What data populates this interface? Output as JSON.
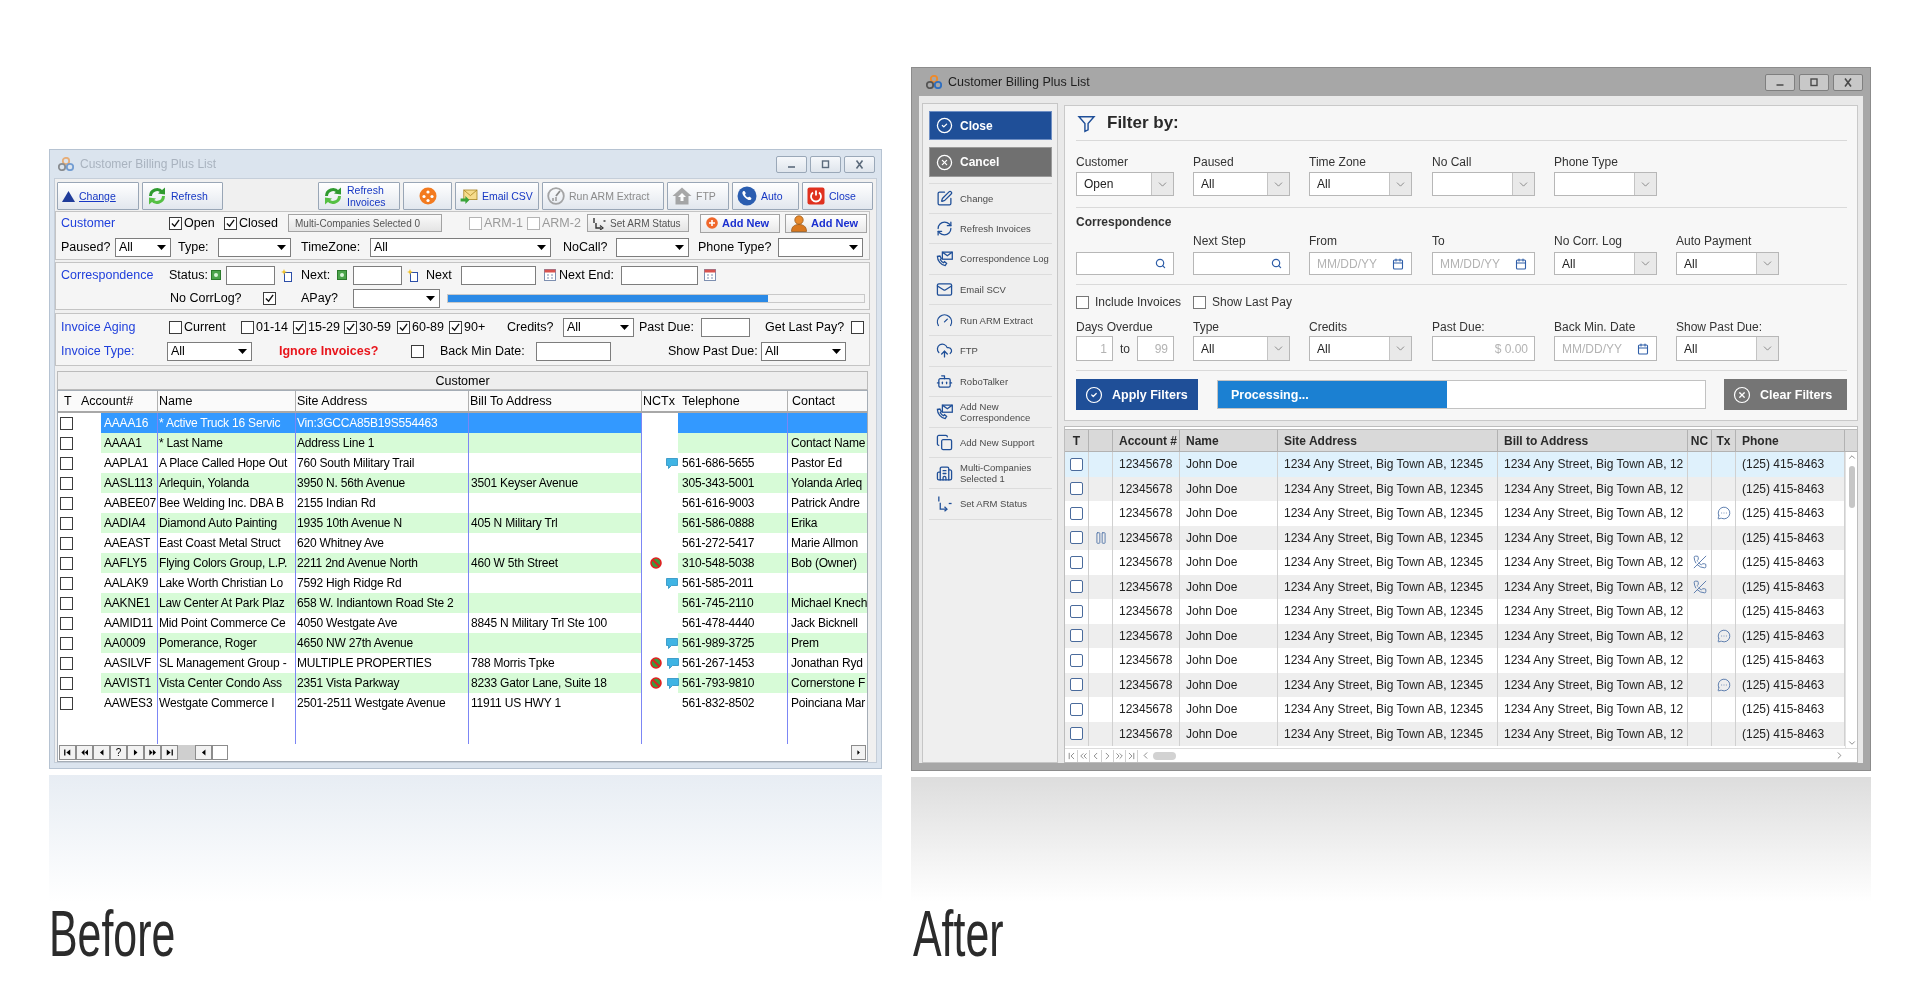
{
  "before_label": "Before",
  "after_label": "After",
  "before_window": {
    "title": "Customer Billing Plus List",
    "toolbar_left": [
      {
        "kind": "change",
        "label": "Change",
        "disabled": false
      },
      {
        "kind": "refresh",
        "label": "Refresh",
        "disabled": false
      }
    ],
    "toolbar_right": [
      {
        "kind": "refresh",
        "label": "Refresh Invoices",
        "disabled": false
      },
      {
        "kind": "record",
        "disabled": false
      },
      {
        "kind": "email",
        "label": "Email CSV",
        "disabled": false
      },
      {
        "kind": "extract",
        "label": "Run ARM Extract",
        "disabled": true
      },
      {
        "kind": "ftp",
        "label": "FTP",
        "disabled": true
      },
      {
        "kind": "auto",
        "label": "Auto",
        "disabled": false
      },
      {
        "kind": "close",
        "label": "Close",
        "disabled": false
      }
    ],
    "customer_section": {
      "title": "Customer",
      "status_checks": [
        {
          "label": "Open",
          "checked": true
        },
        {
          "label": "Closed",
          "checked": true
        }
      ],
      "multi_companies": "Multi-Companies Selected 0",
      "arm_checks": [
        {
          "label": "ARM-1",
          "checked": false,
          "disabled": true
        },
        {
          "label": "ARM-2",
          "checked": false,
          "disabled": true
        }
      ],
      "set_arm_status": "Set ARM Status",
      "add_buttons": [
        {
          "kind": "plus",
          "label": "Add New"
        },
        {
          "kind": "person",
          "label": "Add New"
        }
      ],
      "filters": [
        {
          "label": "Paused?",
          "value": "All"
        },
        {
          "label": "Type:"
        },
        {
          "label": "TimeZone:",
          "value": "All"
        },
        {
          "label": "NoCall?"
        },
        {
          "label": "Phone Type?"
        }
      ]
    },
    "correspondence_section": {
      "title": "Correspondence",
      "status_label": "Status:",
      "next_label": "Next:",
      "next_date_label": "Next",
      "next_end_label": "Next End:",
      "no_corrlog": {
        "label": "No CorrLog?",
        "checked": true
      },
      "apay_label": "APay?",
      "progress": {
        "level": 0.77
      }
    },
    "invoice_section": {
      "aging_title": "Invoice Aging",
      "aging_checks": [
        {
          "label": "Current",
          "checked": false
        },
        {
          "label": "01-14",
          "checked": false
        },
        {
          "label": "15-29",
          "checked": true
        },
        {
          "label": "30-59",
          "checked": true
        },
        {
          "label": "60-89",
          "checked": true
        },
        {
          "label": "90+",
          "checked": true
        }
      ],
      "credits": {
        "label": "Credits?",
        "value": "All"
      },
      "past_due_label": "Past Due:",
      "get_last_pay": {
        "label": "Get Last Pay?",
        "checked": false
      },
      "type_title": "Invoice Type:",
      "type_value": "All",
      "ignore_invoices": {
        "label": "Ignore Invoices?",
        "checked": false
      },
      "back_min_date_label": "Back Min Date:",
      "show_past_due": {
        "label": "Show Past Due:",
        "value": "All"
      }
    },
    "table": {
      "group_header": "Customer",
      "columns": [
        "T",
        "Account#",
        "Name",
        "Site Address",
        "Bill To Address",
        "NCTx",
        "Telephone",
        "Contact"
      ],
      "rows": [
        {
          "checked": false,
          "selected": true,
          "account": "AAAA16",
          "name": "* Active Truck 16 Servic",
          "site_address": "Vin:3GCCA85B19S554463",
          "no_call": false,
          "text_message": false
        },
        {
          "checked": false,
          "selected": false,
          "account": "AAAA1",
          "name": "* Last Name",
          "site_address": "Address Line 1",
          "no_call": false,
          "text_message": false,
          "contact": "Contact Name"
        },
        {
          "checked": false,
          "selected": false,
          "account": "AAPLA1",
          "name": "A Place Called Hope Out",
          "site_address": "760 South Military Trail",
          "no_call": false,
          "text_message": true,
          "telephone": "561-686-5655",
          "contact": "Pastor Ed"
        },
        {
          "checked": false,
          "selected": false,
          "account": "AASL113",
          "name": "Arlequin, Yolanda",
          "site_address": "3950 N. 56th Avenue",
          "bill_to_address": "3501 Keyser Avenue",
          "no_call": false,
          "text_message": false,
          "telephone": "305-343-5001",
          "contact": "Yolanda Arleq"
        },
        {
          "checked": false,
          "selected": false,
          "account": "AABEE07",
          "name": "Bee Welding Inc. DBA B",
          "site_address": "2155 Indian Rd",
          "no_call": false,
          "text_message": false,
          "telephone": "561-616-9003",
          "contact": "Patrick Andre"
        },
        {
          "checked": false,
          "selected": false,
          "account": "AADIA4",
          "name": "Diamond Auto Painting",
          "site_address": "1935 10th Avenue N",
          "bill_to_address": "405 N Military Trl",
          "no_call": false,
          "text_message": false,
          "telephone": "561-586-0888",
          "contact": "Erika"
        },
        {
          "checked": false,
          "selected": false,
          "account": "AAEAST",
          "name": "East Coast Metal Struct",
          "site_address": "620 Whitney Ave",
          "no_call": false,
          "text_message": false,
          "telephone": "561-272-5417",
          "contact": "Marie Allmon"
        },
        {
          "checked": false,
          "selected": false,
          "account": "AAFLY5",
          "name": "Flying Colors Group, L.P.",
          "site_address": "2211 2nd Avenue North",
          "bill_to_address": "460 W 5th Street",
          "no_call": true,
          "text_message": false,
          "telephone": "310-548-5038",
          "contact": "Bob (Owner)"
        },
        {
          "checked": false,
          "selected": false,
          "account": "AALAK9",
          "name": "Lake Worth Christian Lo",
          "site_address": "7592 High Ridge Rd",
          "no_call": false,
          "text_message": true,
          "telephone": "561-585-2011"
        },
        {
          "checked": false,
          "selected": false,
          "account": "AAKNE1",
          "name": "Law Center At Park Plaz",
          "site_address": "658 W. Indiantown Road Ste 2",
          "no_call": false,
          "text_message": false,
          "telephone": "561-745-2110",
          "contact": "Michael Knech"
        },
        {
          "checked": false,
          "selected": false,
          "account": "AAMID11",
          "name": "Mid Point Commerce Ce",
          "site_address": "4050 Westgate Ave",
          "bill_to_address": "8845 N Military Trl Ste 100",
          "no_call": false,
          "text_message": false,
          "telephone": "561-478-4440",
          "contact": "Jack Bicknell"
        },
        {
          "checked": false,
          "selected": false,
          "account": "AA0009",
          "name": "Pomerance, Roger",
          "site_address": "4650 NW 27th Avenue",
          "no_call": false,
          "text_message": true,
          "telephone": "561-989-3725",
          "contact": "Prem"
        },
        {
          "checked": false,
          "selected": false,
          "account": "AASILVF",
          "name": "SL Management Group -",
          "site_address": "MULTIPLE PROPERTIES",
          "bill_to_address": "788 Morris Tpke",
          "no_call": true,
          "text_message": true,
          "telephone": "561-267-1453",
          "contact": "Jonathan Ryd"
        },
        {
          "checked": false,
          "selected": false,
          "account": "AAVIST1",
          "name": "Vista Center Condo Ass",
          "site_address": "2351 Vista Parkway",
          "bill_to_address": "8233 Gator Lane, Suite 18",
          "no_call": true,
          "text_message": true,
          "telephone": "561-793-9810",
          "contact": "Cornerstone F"
        },
        {
          "checked": false,
          "selected": false,
          "account": "AAWES3",
          "name": "Westgate Commerce I",
          "site_address": "2501-2511 Westgate Avenue",
          "bill_to_address": "11911 US HWY 1",
          "no_call": false,
          "text_message": false,
          "telephone": "561-832-8502",
          "contact": "Poinciana Mar"
        }
      ],
      "pager_help": "?"
    }
  },
  "after_window": {
    "title": "Customer Billing Plus List",
    "sidebar": {
      "primary": [
        {
          "kind": "close",
          "label": "Close"
        },
        {
          "kind": "cancel",
          "label": "Cancel"
        }
      ],
      "items": [
        {
          "kind": "edit",
          "label": "Change"
        },
        {
          "kind": "refresh",
          "label": "Refresh Invoices"
        },
        {
          "kind": "phone_mail",
          "label": "Correspondence Log"
        },
        {
          "kind": "mail",
          "label": "Email SCV"
        },
        {
          "kind": "gauge",
          "label": "Run ARM Extract"
        },
        {
          "kind": "cloud",
          "label": "FTP"
        },
        {
          "kind": "robot",
          "label": "RoboTalker"
        },
        {
          "kind": "phone_mail",
          "label": "Add New Correspondence"
        },
        {
          "kind": "pages",
          "label": "Add New Support"
        },
        {
          "kind": "buildings",
          "label": "Multi-Companies Selected 1"
        },
        {
          "kind": "numbers",
          "label": "Set ARM Status"
        }
      ]
    },
    "filter": {
      "title": "Filter by:",
      "row_1": [
        {
          "kind": "select",
          "label": "Customer",
          "value": "Open"
        },
        {
          "kind": "select",
          "label": "Paused",
          "value": "All"
        },
        {
          "kind": "select",
          "label": "Time Zone",
          "value": "All"
        },
        {
          "kind": "select",
          "label": "No Call"
        },
        {
          "kind": "select",
          "label": "Phone Type"
        }
      ],
      "correspondence_title": "Correspondence",
      "row_2": [
        {
          "kind": "search"
        },
        {
          "kind": "search",
          "label": "Next Step"
        },
        {
          "kind": "date",
          "label": "From",
          "placeholder": "MM/DD/YY"
        },
        {
          "kind": "date",
          "label": "To",
          "placeholder": "MM/DD/YY"
        },
        {
          "kind": "select",
          "label": "No Corr. Log",
          "value": "All"
        },
        {
          "kind": "select",
          "label": "Auto Payment",
          "value": "All"
        }
      ],
      "checks": [
        {
          "label": "Include Invoices",
          "checked": false
        },
        {
          "label": "Show Last Pay",
          "checked": false
        }
      ],
      "row_3": [
        {
          "kind": "range",
          "label": "Days Overdue",
          "from_placeholder": "1",
          "joiner": "to",
          "to_placeholder": "99"
        },
        {
          "kind": "select",
          "label": "Type",
          "value": "All"
        },
        {
          "kind": "select",
          "label": "Credits",
          "value": "All"
        },
        {
          "kind": "amount",
          "label": "Past Due:",
          "placeholder": "$ 0.00"
        },
        {
          "kind": "date",
          "label": "Back Min. Date",
          "placeholder": "MM/DD/YY"
        },
        {
          "kind": "select",
          "label": "Show Past Due:",
          "value": "All"
        }
      ],
      "apply_button": "Apply Filters",
      "progress": {
        "label": "Processing...",
        "level": 0.47
      },
      "clear_button": "Clear Filters"
    },
    "table": {
      "columns": [
        "T",
        "Account #",
        "Name",
        "Site Address",
        "Bill to Address",
        "NC",
        "Tx",
        "Phone"
      ],
      "rows": [
        {
          "checked": false,
          "selected": true,
          "paused": false,
          "account": "12345678",
          "name": "John Doe",
          "site_address": "1234 Any Street, Big Town AB, 12345",
          "bill_to_address": "1234 Any Street, Big Town AB, 12",
          "no_call": false,
          "text_message": false,
          "phone": "(125) 415-8463"
        },
        {
          "checked": false,
          "selected": false,
          "paused": false,
          "account": "12345678",
          "name": "John Doe",
          "site_address": "1234 Any Street, Big Town AB, 12345",
          "bill_to_address": "1234 Any Street, Big Town AB, 12",
          "no_call": false,
          "text_message": false,
          "phone": "(125) 415-8463"
        },
        {
          "checked": false,
          "selected": false,
          "paused": false,
          "account": "12345678",
          "name": "John Doe",
          "site_address": "1234 Any Street, Big Town AB, 12345",
          "bill_to_address": "1234 Any Street, Big Town AB, 12",
          "no_call": false,
          "text_message": true,
          "phone": "(125) 415-8463"
        },
        {
          "checked": false,
          "selected": false,
          "paused": true,
          "account": "12345678",
          "name": "John Doe",
          "site_address": "1234 Any Street, Big Town AB, 12345",
          "bill_to_address": "1234 Any Street, Big Town AB, 12",
          "no_call": false,
          "text_message": false,
          "phone": "(125) 415-8463"
        },
        {
          "checked": false,
          "selected": false,
          "paused": false,
          "account": "12345678",
          "name": "John Doe",
          "site_address": "1234 Any Street, Big Town AB, 12345",
          "bill_to_address": "1234 Any Street, Big Town AB, 12",
          "no_call": true,
          "text_message": false,
          "phone": "(125) 415-8463"
        },
        {
          "checked": false,
          "selected": false,
          "paused": false,
          "account": "12345678",
          "name": "John Doe",
          "site_address": "1234 Any Street, Big Town AB, 12345",
          "bill_to_address": "1234 Any Street, Big Town AB, 12",
          "no_call": true,
          "text_message": false,
          "phone": "(125) 415-8463"
        },
        {
          "checked": false,
          "selected": false,
          "paused": false,
          "account": "12345678",
          "name": "John Doe",
          "site_address": "1234 Any Street, Big Town AB, 12345",
          "bill_to_address": "1234 Any Street, Big Town AB, 12",
          "no_call": false,
          "text_message": false,
          "phone": "(125) 415-8463"
        },
        {
          "checked": false,
          "selected": false,
          "paused": false,
          "account": "12345678",
          "name": "John Doe",
          "site_address": "1234 Any Street, Big Town AB, 12345",
          "bill_to_address": "1234 Any Street, Big Town AB, 12",
          "no_call": false,
          "text_message": true,
          "phone": "(125) 415-8463"
        },
        {
          "checked": false,
          "selected": false,
          "paused": false,
          "account": "12345678",
          "name": "John Doe",
          "site_address": "1234 Any Street, Big Town AB, 12345",
          "bill_to_address": "1234 Any Street, Big Town AB, 12",
          "no_call": false,
          "text_message": false,
          "phone": "(125) 415-8463"
        },
        {
          "checked": false,
          "selected": false,
          "paused": false,
          "account": "12345678",
          "name": "John Doe",
          "site_address": "1234 Any Street, Big Town AB, 12345",
          "bill_to_address": "1234 Any Street, Big Town AB, 12",
          "no_call": false,
          "text_message": true,
          "phone": "(125) 415-8463"
        },
        {
          "checked": false,
          "selected": false,
          "paused": false,
          "account": "12345678",
          "name": "John Doe",
          "site_address": "1234 Any Street, Big Town AB, 12345",
          "bill_to_address": "1234 Any Street, Big Town AB, 12",
          "no_call": false,
          "text_message": false,
          "phone": "(125) 415-8463"
        },
        {
          "checked": false,
          "selected": false,
          "paused": false,
          "account": "12345678",
          "name": "John Doe",
          "site_address": "1234 Any Street, Big Town AB, 12345",
          "bill_to_address": "1234 Any Street, Big Town AB, 12",
          "no_call": false,
          "text_message": false,
          "phone": "(125) 415-8463"
        }
      ]
    }
  }
}
